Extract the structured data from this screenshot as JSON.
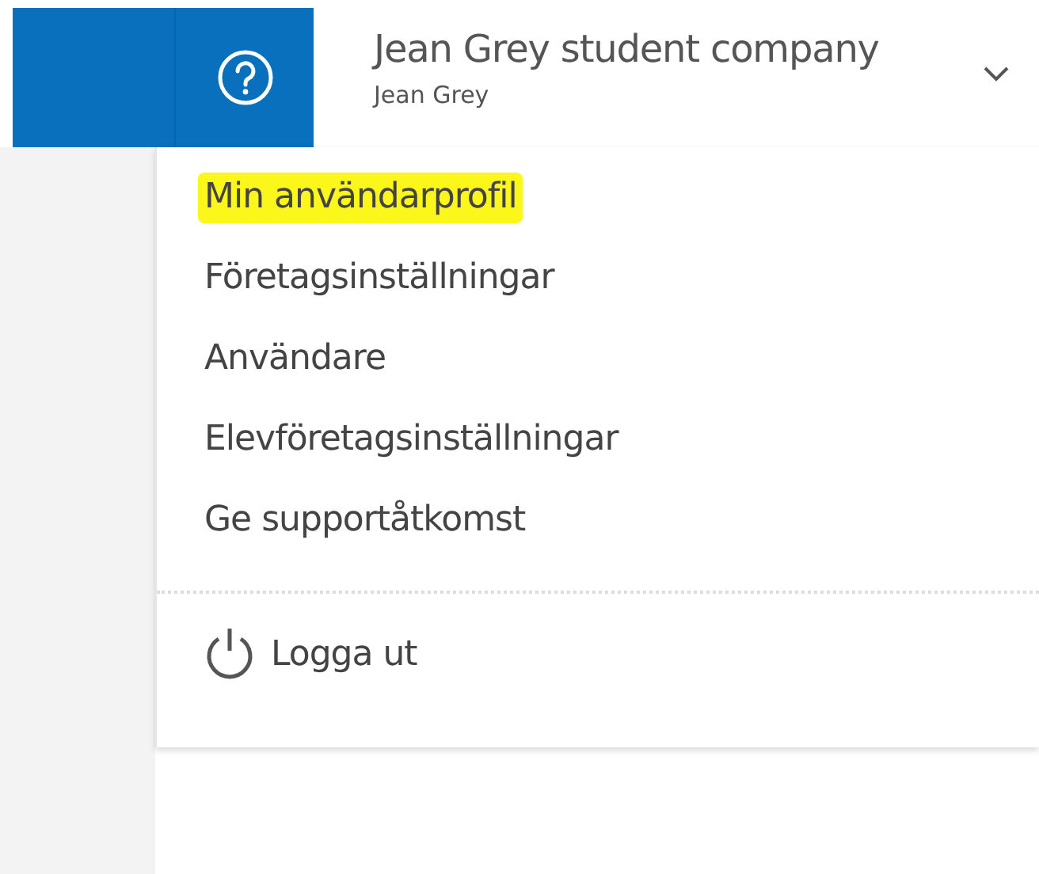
{
  "header": {
    "company": "Jean Grey student company",
    "user": "Jean Grey"
  },
  "menu": {
    "items": [
      {
        "label": "Min användarprofil",
        "highlighted": true
      },
      {
        "label": "Företagsinställningar",
        "highlighted": false
      },
      {
        "label": "Användare",
        "highlighted": false
      },
      {
        "label": "Elevföretagsinställningar",
        "highlighted": false
      },
      {
        "label": "Ge supportåtkomst",
        "highlighted": false
      }
    ],
    "logout": "Logga ut"
  }
}
